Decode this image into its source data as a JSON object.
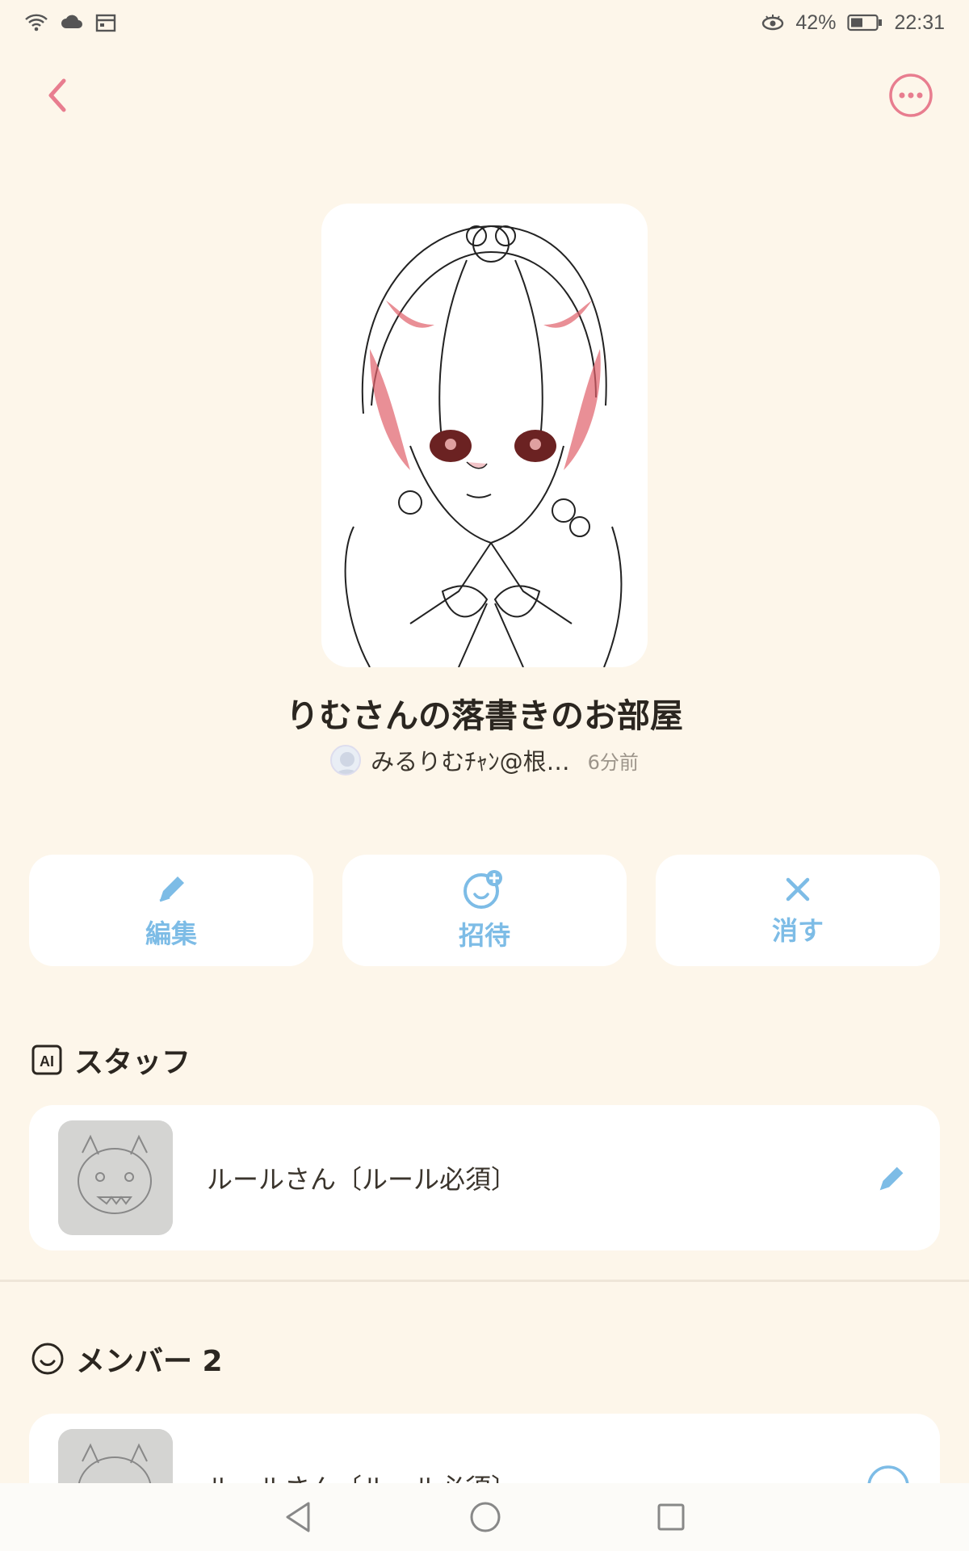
{
  "status_bar": {
    "battery_percent": "42%",
    "time": "22:31"
  },
  "room": {
    "title": "りむさんの落書きのお部屋",
    "owner_name": "みるりむﾁｬﾝ@根…",
    "posted_ago": "6分前"
  },
  "actions": [
    {
      "label": "編集",
      "icon": "pencil-icon"
    },
    {
      "label": "招待",
      "icon": "invite-user-icon"
    },
    {
      "label": "消す",
      "icon": "close-icon"
    }
  ],
  "staff": {
    "heading": "スタッフ",
    "badge": "AI",
    "items": [
      {
        "label": "ルールさん〔ルール必須〕"
      }
    ]
  },
  "members": {
    "heading": "メンバー 2",
    "items": [
      {
        "label": "ルールさん〔ルール必須〕"
      }
    ]
  },
  "colors": {
    "background": "#fdf6ea",
    "accent_pink": "#e87d8f",
    "accent_blue": "#7dbce6"
  }
}
